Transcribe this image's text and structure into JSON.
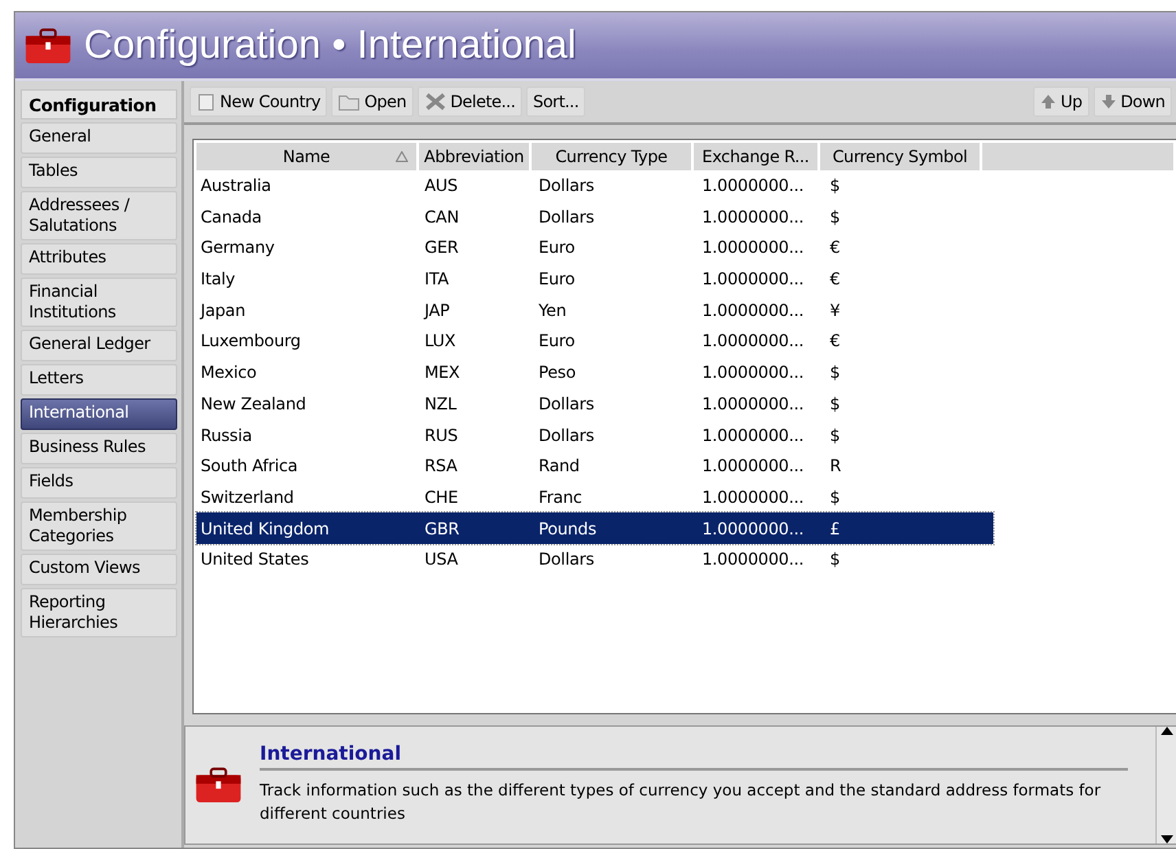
{
  "window": {
    "title": "Configuration",
    "separator": "•",
    "subtitle": "International"
  },
  "sidebar": {
    "header": "Configuration",
    "items": [
      {
        "label": "General",
        "selected": false
      },
      {
        "label": "Tables",
        "selected": false
      },
      {
        "label": "Addressees / Salutations",
        "selected": false
      },
      {
        "label": "Attributes",
        "selected": false
      },
      {
        "label": "Financial Institutions",
        "selected": false
      },
      {
        "label": "General Ledger",
        "selected": false
      },
      {
        "label": "Letters",
        "selected": false
      },
      {
        "label": "International",
        "selected": true
      },
      {
        "label": "Business Rules",
        "selected": false
      },
      {
        "label": "Fields",
        "selected": false
      },
      {
        "label": "Membership Categories",
        "selected": false
      },
      {
        "label": "Custom Views",
        "selected": false
      },
      {
        "label": "Reporting Hierarchies",
        "selected": false
      }
    ]
  },
  "toolbar": {
    "left": [
      {
        "label": "New Country",
        "kind": "new"
      },
      {
        "label": "Open",
        "kind": "open"
      },
      {
        "label": "Delete...",
        "kind": "delete"
      },
      {
        "label": "Sort...",
        "kind": "none"
      }
    ],
    "right": [
      {
        "label": "Up",
        "kind": "up"
      },
      {
        "label": "Down",
        "kind": "down"
      }
    ]
  },
  "table": {
    "columns": [
      {
        "label": "Name",
        "sorted": true
      },
      {
        "label": "Abbreviation",
        "sorted": false
      },
      {
        "label": "Currency Type",
        "sorted": false
      },
      {
        "label": "Exchange R...",
        "sorted": false
      },
      {
        "label": "Currency Symbol",
        "sorted": false
      }
    ],
    "rows": [
      {
        "cells": [
          "Australia",
          "AUS",
          "Dollars",
          "1.0000000...",
          "$"
        ],
        "selected": false
      },
      {
        "cells": [
          "Canada",
          "CAN",
          "Dollars",
          "1.0000000...",
          "$"
        ],
        "selected": false
      },
      {
        "cells": [
          "Germany",
          "GER",
          "Euro",
          "1.0000000...",
          "€"
        ],
        "selected": false
      },
      {
        "cells": [
          "Italy",
          "ITA",
          "Euro",
          "1.0000000...",
          "€"
        ],
        "selected": false
      },
      {
        "cells": [
          "Japan",
          "JAP",
          "Yen",
          "1.0000000...",
          "¥"
        ],
        "selected": false
      },
      {
        "cells": [
          "Luxembourg",
          "LUX",
          "Euro",
          "1.0000000...",
          "€"
        ],
        "selected": false
      },
      {
        "cells": [
          "Mexico",
          "MEX",
          "Peso",
          "1.0000000...",
          "$"
        ],
        "selected": false
      },
      {
        "cells": [
          "New Zealand",
          "NZL",
          "Dollars",
          "1.0000000...",
          "$"
        ],
        "selected": false
      },
      {
        "cells": [
          "Russia",
          "RUS",
          "Dollars",
          "1.0000000...",
          "$"
        ],
        "selected": false
      },
      {
        "cells": [
          "South Africa",
          "RSA",
          "Rand",
          "1.0000000...",
          "R"
        ],
        "selected": false
      },
      {
        "cells": [
          "Switzerland",
          "CHE",
          "Franc",
          "1.0000000...",
          "$"
        ],
        "selected": false
      },
      {
        "cells": [
          "United Kingdom",
          "GBR",
          "Pounds",
          "1.0000000...",
          "£"
        ],
        "selected": true
      },
      {
        "cells": [
          "United States",
          "USA",
          "Dollars",
          "1.0000000...",
          "$"
        ],
        "selected": false
      }
    ]
  },
  "info": {
    "title": "International",
    "text": "Track information such as the different types of currency you accept and the standard address formats for different countries"
  }
}
